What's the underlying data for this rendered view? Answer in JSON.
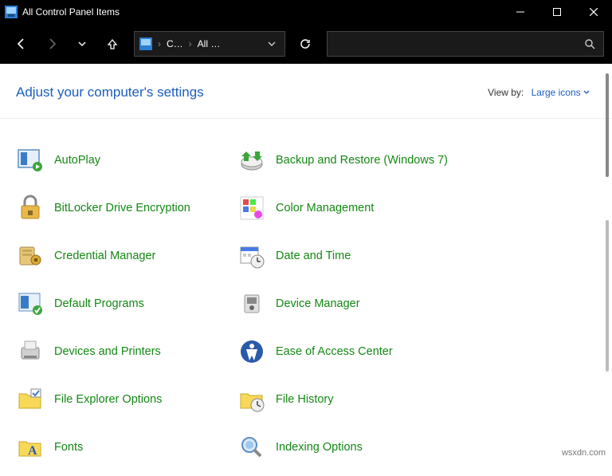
{
  "titlebar": {
    "title": "All Control Panel Items"
  },
  "breadcrumb": {
    "part1": "C…",
    "part2": "All …"
  },
  "header": {
    "heading": "Adjust your computer's settings",
    "viewby_label": "View by:",
    "viewby_value": "Large icons"
  },
  "items": [
    {
      "label": "AutoPlay",
      "icon": "autoplay-icon"
    },
    {
      "label": "Backup and Restore (Windows 7)",
      "icon": "backup-icon"
    },
    {
      "label": "BitLocker Drive Encryption",
      "icon": "bitlocker-icon"
    },
    {
      "label": "Color Management",
      "icon": "color-mgmt-icon"
    },
    {
      "label": "Credential Manager",
      "icon": "credential-icon"
    },
    {
      "label": "Date and Time",
      "icon": "datetime-icon"
    },
    {
      "label": "Default Programs",
      "icon": "default-programs-icon"
    },
    {
      "label": "Device Manager",
      "icon": "device-mgr-icon"
    },
    {
      "label": "Devices and Printers",
      "icon": "devices-printers-icon"
    },
    {
      "label": "Ease of Access Center",
      "icon": "ease-access-icon"
    },
    {
      "label": "File Explorer Options",
      "icon": "file-explorer-icon"
    },
    {
      "label": "File History",
      "icon": "file-history-icon"
    },
    {
      "label": "Fonts",
      "icon": "fonts-icon"
    },
    {
      "label": "Indexing Options",
      "icon": "indexing-icon"
    }
  ],
  "watermark": "wsxdn.com"
}
